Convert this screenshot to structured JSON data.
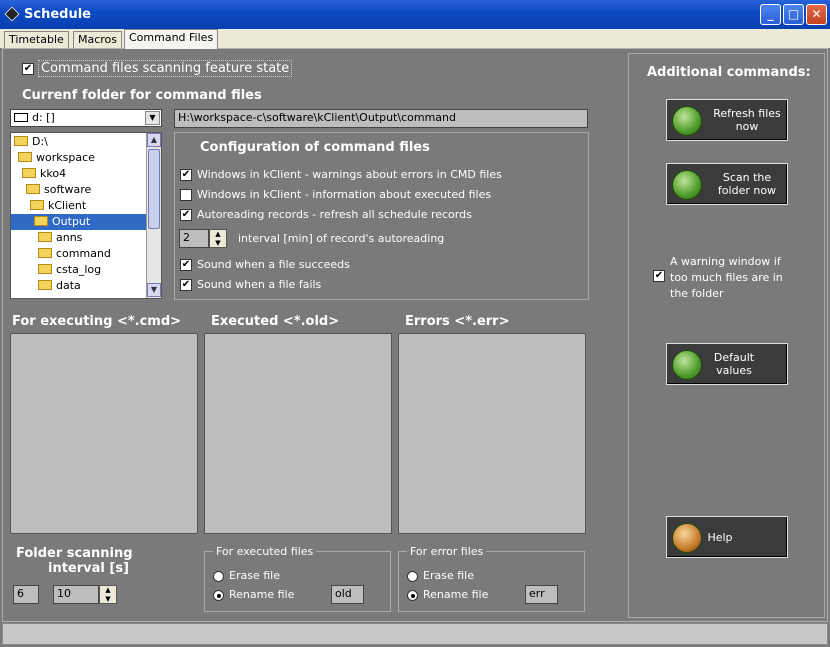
{
  "window": {
    "title": "Schedule"
  },
  "tabs": [
    {
      "label": "Timetable"
    },
    {
      "label": "Macros"
    },
    {
      "label": "Command Files"
    }
  ],
  "feature_state": {
    "label": "Command files scanning feature state",
    "checked": true
  },
  "current_folder": {
    "heading": "Currenf folder for command files",
    "drive": "d: []",
    "path": "H:\\workspace-c\\software\\kClient\\Output\\command",
    "tree": [
      "D:\\",
      "workspace",
      "kko4",
      "software",
      "kClient",
      "Output",
      "anns",
      "command",
      "csta_log",
      "data"
    ]
  },
  "config": {
    "heading": "Configuration of command files",
    "options": [
      {
        "label": "Windows in kClient - warnings about errors in CMD files",
        "checked": true
      },
      {
        "label": "Windows in kClient - information about executed files",
        "checked": false
      },
      {
        "label": "Autoreading records - refresh all schedule records",
        "checked": true
      }
    ],
    "interval_value": "2",
    "interval_label": "interval [min] of record's autoreading",
    "sounds": [
      {
        "label": "Sound when a file succeeds",
        "checked": true
      },
      {
        "label": "Sound when a file fails",
        "checked": true
      }
    ]
  },
  "lists": {
    "executing": "For executing <*.cmd>",
    "executed": "Executed <*.old>",
    "errors": "Errors <*.err>"
  },
  "scanning": {
    "label_line1": "Folder scanning",
    "label_line2": "interval [s]",
    "value_a": "6",
    "value_b": "10"
  },
  "executed_files": {
    "legend": "For executed files",
    "erase": "Erase file",
    "rename": "Rename file",
    "ext": "old"
  },
  "error_files": {
    "legend": "For error files",
    "erase": "Erase file",
    "rename": "Rename file",
    "ext": "err"
  },
  "additional": {
    "heading": "Additional commands:",
    "refresh": "Refresh files now",
    "scan": "Scan the folder now",
    "warning": "A warning window if too much files are in the folder",
    "warning_checked": true,
    "defaults": "Default values",
    "help": "Help"
  },
  "check_glyph": "✔"
}
